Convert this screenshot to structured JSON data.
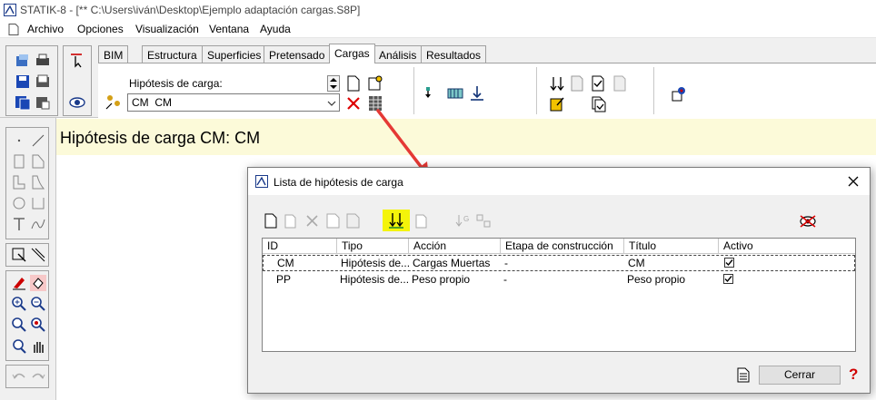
{
  "window": {
    "title": "STATIK-8 - [** C:\\Users\\iván\\Desktop\\Ejemplo adaptación cargas.S8P]"
  },
  "menu": {
    "items": [
      "Archivo",
      "Opciones",
      "Visualización",
      "Ventana",
      "Ayuda"
    ]
  },
  "tabs": {
    "items": [
      "BIM",
      "Estructura",
      "Superficies",
      "Pretensado",
      "Cargas",
      "Análisis",
      "Resultados"
    ],
    "active": "Cargas"
  },
  "load_hypothesis": {
    "label": "Hipótesis de carga:",
    "selected": "CM  CM"
  },
  "banner": {
    "text": "Hipótesis de carga CM: CM"
  },
  "dialog": {
    "title": "Lista de hipótesis de carga",
    "columns": [
      "ID",
      "Tipo",
      "Acción",
      "Etapa de construcción",
      "Título",
      "Activo"
    ],
    "rows": [
      {
        "id": "CM",
        "tipo": "Hipótesis de...",
        "accion": "Cargas Muertas",
        "etapa": "-",
        "titulo": "CM",
        "activo": true
      },
      {
        "id": "PP",
        "tipo": "Hipótesis de...",
        "accion": "Peso propio",
        "etapa": "-",
        "titulo": "Peso propio",
        "activo": true
      }
    ],
    "close_button": "Cerrar",
    "help_glyph": "?"
  },
  "colors": {
    "banner_bg": "#fcfad9",
    "arrow": "#e53935",
    "highlight_icon_bg": "#f4f40a",
    "help": "#d00000"
  },
  "icons": [
    "app-icon",
    "document-icon",
    "cursor-select-icon",
    "eye-icon",
    "paste-icon",
    "delete-x-icon",
    "table-grid-icon",
    "sort-icon",
    "close-icon",
    "no-visibility-icon"
  ]
}
